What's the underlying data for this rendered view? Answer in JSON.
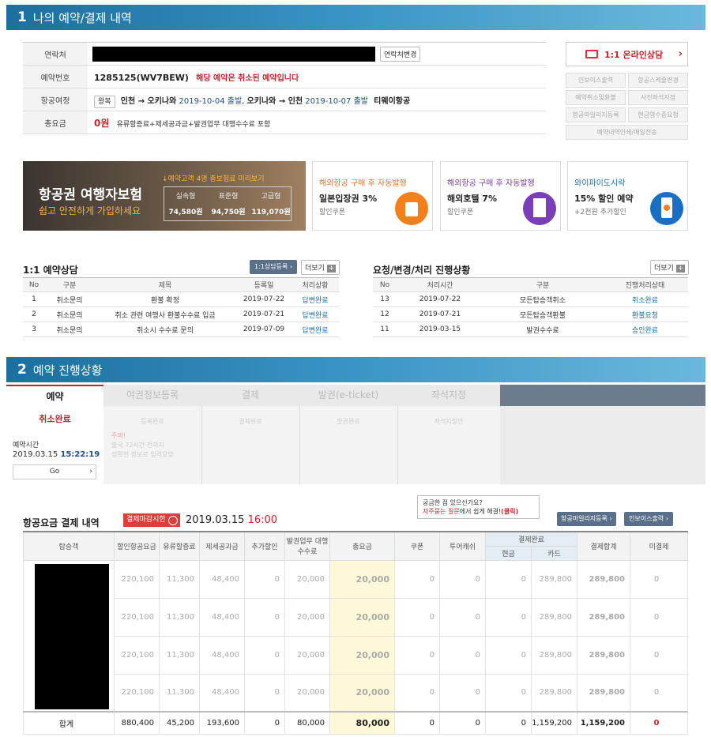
{
  "sec1": {
    "num": "1",
    "title": "나의 예약/결제 내역"
  },
  "info": {
    "contact_label": "연락처",
    "contact_change_btn": "연락처변경",
    "resv_label": "예약번호",
    "resv_no": "1285125(WV7BEW)",
    "resv_status": "해당 예약은 취소된 예약입니다",
    "itin_label": "항공여정",
    "trip_type": "왕복",
    "itin_a": "인천 → 오키나와",
    "itin_a_date": "2019-10-04 출발",
    "itin_sep": ", ",
    "itin_b": "오키나와 → 인천",
    "itin_b_date": "2019-10-07 출발",
    "airline": "티웨이항공",
    "total_label": "총요금",
    "total_value": "0원",
    "total_note": "유류할증료+제세공과금+발권업무 대행수수료 포함"
  },
  "side": {
    "consult": "1:1 온라인상담",
    "buttons": [
      "인보이스출력",
      "항공스케줄변경",
      "예약취소및환불",
      "사전좌석지정",
      "항공마일리지등록",
      "현금영수증요청",
      "예약내역인쇄/메일전송"
    ]
  },
  "banners": {
    "b1_title": "항공권 여행자보험",
    "b1_sub": "쉽고 안전하게 가입하세요",
    "b1_note": "↓예약고객 4명 총보험료 미리보기",
    "b1_heads": [
      "실속형",
      "표준형",
      "고급형"
    ],
    "b1_vals": [
      "74,580원",
      "94,750원",
      "119,070원"
    ],
    "b2_top": "해외항공 구매 후 자동발행",
    "b2_title": "일본입장권 3%",
    "b2_sub": "할인쿠폰",
    "b3_top": "해외항공 구매 후 자동발행",
    "b3_title": "해외호텔 7%",
    "b3_sub": "할인쿠폰",
    "b4_top": "와이파이도시락",
    "b4_title": "15% 할인 예약",
    "b4_sub": "+2천원 추가할인"
  },
  "consult": {
    "title": "1:1 예약상담",
    "reg_btn": "1:1상담등록",
    "more_btn": "더보기",
    "headers": [
      "No",
      "구분",
      "제목",
      "등록일",
      "처리상황"
    ],
    "rows": [
      [
        "1",
        "취소문의",
        "환불 확정",
        "2019-07-22",
        "답변완료"
      ],
      [
        "2",
        "취소문의",
        "취소 관련 여행사 환불수수료 입금",
        "2019-07-21",
        "답변완료"
      ],
      [
        "3",
        "취소문의",
        "취소시 수수료 문의",
        "2019-07-09",
        "답변완료"
      ]
    ]
  },
  "req": {
    "title": "요청/변경/처리 진행상황",
    "more_btn": "더보기",
    "headers": [
      "No",
      "처리시간",
      "구분",
      "진행처리상태"
    ],
    "rows": [
      [
        "13",
        "2019-07-22",
        "모든탑승객취소",
        "취소완료"
      ],
      [
        "12",
        "2019-07-21",
        "모든탑승객환불",
        "환불요청"
      ],
      [
        "11",
        "2019-03-15",
        "발권수수료",
        "승인완료"
      ]
    ]
  },
  "sec2": {
    "num": "2",
    "title": "예약 진행상황"
  },
  "steps": {
    "labels": [
      "예약",
      "여권정보등록",
      "결제",
      "발권(e-ticket)",
      "좌석지정"
    ],
    "status": "취소완료",
    "resv_time_label": "예약시간",
    "resv_time_date": "2019.03.15",
    "resv_time_clock": "15:22:19",
    "go_btn": "Go",
    "sub": [
      "등록완료",
      "결제완료",
      "발권완료",
      "좌석지정안"
    ],
    "note1": "주의!",
    "note2": "출국 72시간 전까지",
    "note3": "정확한 정보로 입력요망"
  },
  "pay": {
    "title": "항공요금 결제 내역",
    "deadline_badge": "결제마감시한",
    "deadline_date": "2019.03.15",
    "deadline_time": "16:00",
    "tip1": "궁금한 점 있으신가요?",
    "tip2a": "자주묻는 질문",
    "tip2b": "에서 쉽게 해결!",
    "tip2c": "(클릭)",
    "mileage_btn": "항공마일리지등록",
    "invoice_btn": "인보이스출력",
    "headers": {
      "pax": "탑승객",
      "disc": "할인항공요금",
      "fuel": "유류할증료",
      "tax": "제세공과금",
      "add": "추가할인",
      "agency": "발권업무 대행수수료",
      "total": "총요금",
      "coupon": "쿠폰",
      "tour": "투어캐쉬",
      "done": "결제완료",
      "cash": "현금",
      "card": "카드",
      "sum": "결제합계",
      "unpaid": "미결제"
    },
    "rows": [
      [
        "220,100",
        "11,300",
        "48,400",
        "0",
        "20,000",
        "20,000",
        "0",
        "0",
        "0",
        "289,800",
        "289,800",
        "0"
      ],
      [
        "220,100",
        "11,300",
        "48,400",
        "0",
        "20,000",
        "20,000",
        "0",
        "0",
        "0",
        "289,800",
        "289,800",
        "0"
      ],
      [
        "220,100",
        "11,300",
        "48,400",
        "0",
        "20,000",
        "20,000",
        "0",
        "0",
        "0",
        "289,800",
        "289,800",
        "0"
      ],
      [
        "220,100",
        "11,300",
        "48,400",
        "0",
        "20,000",
        "20,000",
        "0",
        "0",
        "0",
        "289,800",
        "289,800",
        "0"
      ]
    ],
    "sum_label": "합계",
    "sum_row": [
      "880,400",
      "45,200",
      "193,600",
      "0",
      "80,000",
      "80,000",
      "0",
      "0",
      "0",
      "1,159,200",
      "1,159,200",
      "0"
    ]
  }
}
